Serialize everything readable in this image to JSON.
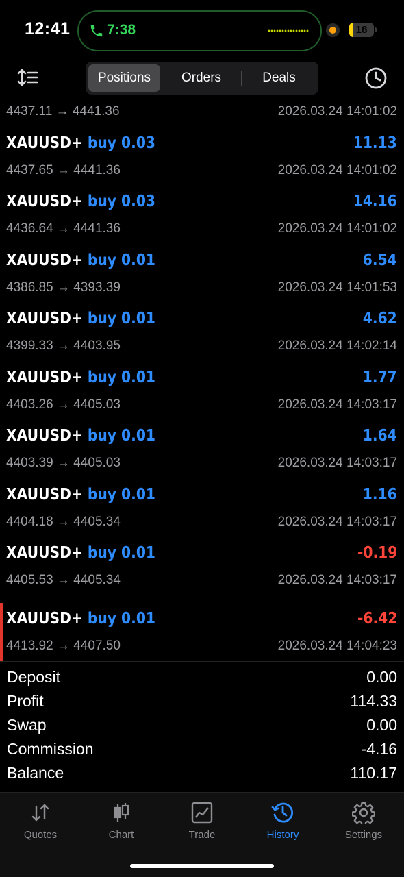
{
  "status_bar": {
    "time": "12:41",
    "call_time": "7:38",
    "battery": "18",
    "battery_level": 0.18
  },
  "header": {
    "tabs": [
      {
        "label": "Positions",
        "active": true
      },
      {
        "label": "Orders",
        "active": false
      },
      {
        "label": "Deals",
        "active": false
      }
    ],
    "icons": {
      "left": "sort-icon",
      "right": "history-clock-icon"
    }
  },
  "partial_row": {
    "prices": "4437.11 → 4441.36",
    "time": "2026.03.24 14:01:02"
  },
  "deals": [
    {
      "symbol": "XAUUSD+",
      "side": "buy 0.03",
      "profit": "11.13",
      "prices": "4437.65 → 4441.36",
      "time": "2026.03.24 14:01:02"
    },
    {
      "symbol": "XAUUSD+",
      "side": "buy 0.03",
      "profit": "14.16",
      "prices": "4436.64 → 4441.36",
      "time": "2026.03.24 14:01:02"
    },
    {
      "symbol": "XAUUSD+",
      "side": "buy 0.01",
      "profit": "6.54",
      "prices": "4386.85 → 4393.39",
      "time": "2026.03.24 14:01:53"
    },
    {
      "symbol": "XAUUSD+",
      "side": "buy 0.01",
      "profit": "4.62",
      "prices": "4399.33 → 4403.95",
      "time": "2026.03.24 14:02:14"
    },
    {
      "symbol": "XAUUSD+",
      "side": "buy 0.01",
      "profit": "1.77",
      "prices": "4403.26 → 4405.03",
      "time": "2026.03.24 14:03:17"
    },
    {
      "symbol": "XAUUSD+",
      "side": "buy 0.01",
      "profit": "1.64",
      "prices": "4403.39 → 4405.03",
      "time": "2026.03.24 14:03:17"
    },
    {
      "symbol": "XAUUSD+",
      "side": "buy 0.01",
      "profit": "1.16",
      "prices": "4404.18 → 4405.34",
      "time": "2026.03.24 14:03:17"
    },
    {
      "symbol": "XAUUSD+",
      "side": "buy 0.01",
      "profit": "-0.19",
      "prices": "4405.53 → 4405.34",
      "time": "2026.03.24 14:03:17"
    },
    {
      "symbol": "XAUUSD+",
      "side": "buy 0.01",
      "profit": "-6.42",
      "prices": "4413.92 → 4407.50",
      "time": "2026.03.24 14:04:23"
    }
  ],
  "summary": [
    {
      "label": "Deposit",
      "value": "0.00"
    },
    {
      "label": "Profit",
      "value": "114.33"
    },
    {
      "label": "Swap",
      "value": "0.00"
    },
    {
      "label": "Commission",
      "value": "-4.16"
    },
    {
      "label": "Balance",
      "value": "110.17"
    }
  ],
  "tabbar": [
    {
      "label": "Quotes",
      "icon": "quotes-icon",
      "active": false
    },
    {
      "label": "Chart",
      "icon": "candlestick-chart-icon",
      "active": false
    },
    {
      "label": "Trade",
      "icon": "trade-chart-icon",
      "active": false
    },
    {
      "label": "History",
      "icon": "history-icon",
      "active": true
    },
    {
      "label": "Settings",
      "icon": "gear-icon",
      "active": false
    }
  ],
  "colors": {
    "accent_blue": "#2f8cff",
    "loss_red": "#ff453a",
    "call_green": "#34d65a",
    "muted_text": "#9e9ea3"
  }
}
